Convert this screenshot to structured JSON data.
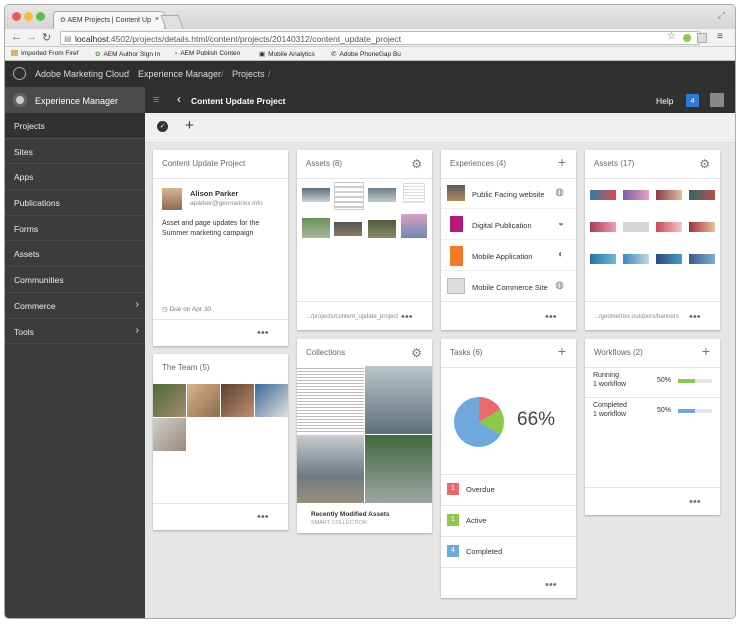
{
  "browser": {
    "tab_title": "AEM Projects | Content Up",
    "url_host": "localhost",
    "url_rest": ":4502/projects/details.html/content/projects/20140312/content_update_project",
    "bookmarks": [
      "Imported From Firef",
      "AEM Author Sign In",
      "AEM Publish Conten",
      "Mobile Analytics",
      "Adobe PhoneGap Bu"
    ]
  },
  "globalnav": {
    "brand": "Adobe Marketing Cloud",
    "sep": "/",
    "crumb1": "Experience Manager",
    "crumb2": "Projects"
  },
  "sidebar": {
    "title": "Experience Manager",
    "items": [
      {
        "label": "Projects"
      },
      {
        "label": "Sites"
      },
      {
        "label": "Apps"
      },
      {
        "label": "Publications"
      },
      {
        "label": "Forms"
      },
      {
        "label": "Assets"
      },
      {
        "label": "Communities"
      },
      {
        "label": "Commerce"
      },
      {
        "label": "Tools"
      }
    ]
  },
  "topbar": {
    "title": "Content Update Project",
    "help": "Help",
    "notifications": "4"
  },
  "cards": {
    "project": {
      "title": "Content Update Project",
      "name": "Alison Parker",
      "email": "aparker@geometrixx.info",
      "desc": "Asset and page updates for the Summer marketing campaign",
      "due": "Due on Apr 30"
    },
    "assets1": {
      "title": "Assets (8)",
      "path": ".../projects/content_update_project"
    },
    "experiences": {
      "title": "Experiences (4)",
      "items": [
        {
          "label": "Public Facing website"
        },
        {
          "label": "Digital Publication"
        },
        {
          "label": "Mobile Application"
        },
        {
          "label": "Mobile Commerce Site"
        }
      ]
    },
    "assets2": {
      "title": "Assets (17)",
      "path": ".../geometrixx-outdoors/banners"
    },
    "team": {
      "title": "The Team (5)"
    },
    "collections": {
      "title": "Collections",
      "name": "Recently Modified Assets",
      "type": "SMART COLLECTION"
    },
    "tasks": {
      "title": "Tasks (6)",
      "percent": "66%",
      "items": [
        {
          "num": "1",
          "label": "Overdue",
          "color": "#e86b6b"
        },
        {
          "num": "1",
          "label": "Active",
          "color": "#8cc84b"
        },
        {
          "num": "4",
          "label": "Completed",
          "color": "#6fa8dc"
        }
      ]
    },
    "workflows": {
      "title": "Workflows (2)",
      "items": [
        {
          "state": "Running",
          "count": "1 workflow",
          "pct": "50%",
          "fill": 0.5,
          "color": "#8cc84b"
        },
        {
          "state": "Completed",
          "count": "1 workflow",
          "pct": "50%",
          "fill": 0.5,
          "color": "#6fa8dc"
        }
      ]
    }
  },
  "more_label": "•••"
}
